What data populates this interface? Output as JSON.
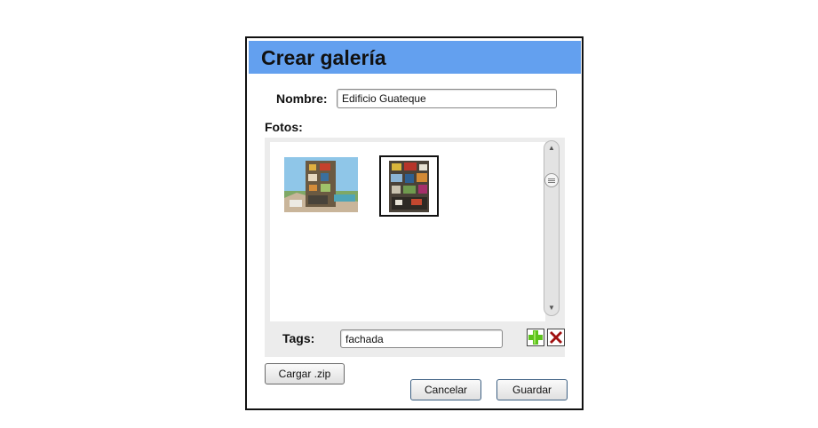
{
  "dialog": {
    "title": "Crear galería",
    "name_label": "Nombre:",
    "name_value": "Edificio Guateque",
    "photos_label": "Fotos:",
    "photos": [
      {
        "icon": "building-photo",
        "selected": false
      },
      {
        "icon": "building-photo",
        "selected": true
      }
    ],
    "tags_label": "Tags:",
    "tags_value": "fachada",
    "add_tag_icon": "plus-icon",
    "remove_tag_icon": "x-icon",
    "upload_zip_label": "Cargar .zip",
    "cancel_label": "Cancelar",
    "save_label": "Guardar"
  },
  "colors": {
    "titlebar": "#63a0ef",
    "add_green": "#5cc21c",
    "remove_red": "#a01010"
  }
}
